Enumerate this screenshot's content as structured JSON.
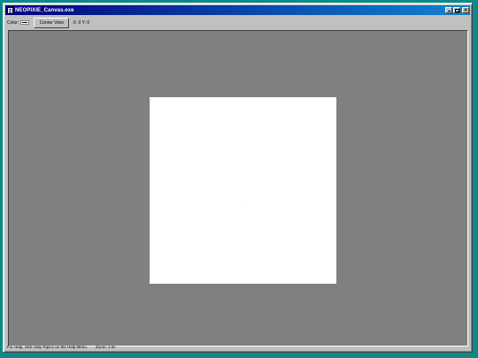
{
  "window": {
    "title": "NEOPIXIE_Canvas.exe"
  },
  "toolbar": {
    "color_label": "Color:",
    "current_color": "#000000",
    "center_view_label": "Center View",
    "coords_text": "X: 0 Y: 0"
  },
  "canvas": {
    "background_color": "#ffffff",
    "workspace_color": "#808080"
  },
  "statusbar": {
    "help_text": "For Help, click Help Topics on the Help Menu.",
    "zoom_text": "Zoom: 1.0x"
  },
  "colors": {
    "desktop": "#0c8a8a",
    "titlebar_start": "#000080",
    "titlebar_end": "#1084d0",
    "chrome": "#c0c0c0"
  },
  "icons": {
    "app": "document-icon",
    "minimize": "minimize-icon",
    "maximize": "maximize-icon",
    "close": "close-icon"
  }
}
